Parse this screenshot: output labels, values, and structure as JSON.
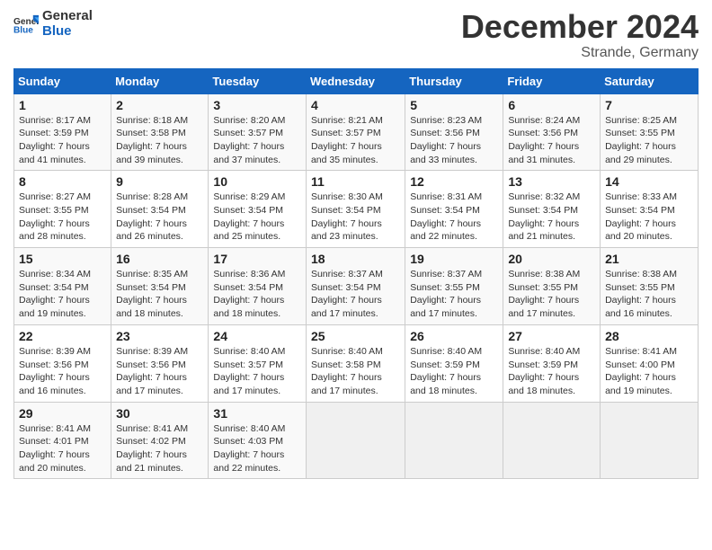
{
  "logo": {
    "line1": "General",
    "line2": "Blue"
  },
  "title": "December 2024",
  "subtitle": "Strande, Germany",
  "weekdays": [
    "Sunday",
    "Monday",
    "Tuesday",
    "Wednesday",
    "Thursday",
    "Friday",
    "Saturday"
  ],
  "weeks": [
    [
      {
        "day": "1",
        "sunrise": "8:17 AM",
        "sunset": "3:59 PM",
        "daylight": "7 hours and 41 minutes."
      },
      {
        "day": "2",
        "sunrise": "8:18 AM",
        "sunset": "3:58 PM",
        "daylight": "7 hours and 39 minutes."
      },
      {
        "day": "3",
        "sunrise": "8:20 AM",
        "sunset": "3:57 PM",
        "daylight": "7 hours and 37 minutes."
      },
      {
        "day": "4",
        "sunrise": "8:21 AM",
        "sunset": "3:57 PM",
        "daylight": "7 hours and 35 minutes."
      },
      {
        "day": "5",
        "sunrise": "8:23 AM",
        "sunset": "3:56 PM",
        "daylight": "7 hours and 33 minutes."
      },
      {
        "day": "6",
        "sunrise": "8:24 AM",
        "sunset": "3:56 PM",
        "daylight": "7 hours and 31 minutes."
      },
      {
        "day": "7",
        "sunrise": "8:25 AM",
        "sunset": "3:55 PM",
        "daylight": "7 hours and 29 minutes."
      }
    ],
    [
      {
        "day": "8",
        "sunrise": "8:27 AM",
        "sunset": "3:55 PM",
        "daylight": "7 hours and 28 minutes."
      },
      {
        "day": "9",
        "sunrise": "8:28 AM",
        "sunset": "3:54 PM",
        "daylight": "7 hours and 26 minutes."
      },
      {
        "day": "10",
        "sunrise": "8:29 AM",
        "sunset": "3:54 PM",
        "daylight": "7 hours and 25 minutes."
      },
      {
        "day": "11",
        "sunrise": "8:30 AM",
        "sunset": "3:54 PM",
        "daylight": "7 hours and 23 minutes."
      },
      {
        "day": "12",
        "sunrise": "8:31 AM",
        "sunset": "3:54 PM",
        "daylight": "7 hours and 22 minutes."
      },
      {
        "day": "13",
        "sunrise": "8:32 AM",
        "sunset": "3:54 PM",
        "daylight": "7 hours and 21 minutes."
      },
      {
        "day": "14",
        "sunrise": "8:33 AM",
        "sunset": "3:54 PM",
        "daylight": "7 hours and 20 minutes."
      }
    ],
    [
      {
        "day": "15",
        "sunrise": "8:34 AM",
        "sunset": "3:54 PM",
        "daylight": "7 hours and 19 minutes."
      },
      {
        "day": "16",
        "sunrise": "8:35 AM",
        "sunset": "3:54 PM",
        "daylight": "7 hours and 18 minutes."
      },
      {
        "day": "17",
        "sunrise": "8:36 AM",
        "sunset": "3:54 PM",
        "daylight": "7 hours and 18 minutes."
      },
      {
        "day": "18",
        "sunrise": "8:37 AM",
        "sunset": "3:54 PM",
        "daylight": "7 hours and 17 minutes."
      },
      {
        "day": "19",
        "sunrise": "8:37 AM",
        "sunset": "3:55 PM",
        "daylight": "7 hours and 17 minutes."
      },
      {
        "day": "20",
        "sunrise": "8:38 AM",
        "sunset": "3:55 PM",
        "daylight": "7 hours and 17 minutes."
      },
      {
        "day": "21",
        "sunrise": "8:38 AM",
        "sunset": "3:55 PM",
        "daylight": "7 hours and 16 minutes."
      }
    ],
    [
      {
        "day": "22",
        "sunrise": "8:39 AM",
        "sunset": "3:56 PM",
        "daylight": "7 hours and 16 minutes."
      },
      {
        "day": "23",
        "sunrise": "8:39 AM",
        "sunset": "3:56 PM",
        "daylight": "7 hours and 17 minutes."
      },
      {
        "day": "24",
        "sunrise": "8:40 AM",
        "sunset": "3:57 PM",
        "daylight": "7 hours and 17 minutes."
      },
      {
        "day": "25",
        "sunrise": "8:40 AM",
        "sunset": "3:58 PM",
        "daylight": "7 hours and 17 minutes."
      },
      {
        "day": "26",
        "sunrise": "8:40 AM",
        "sunset": "3:59 PM",
        "daylight": "7 hours and 18 minutes."
      },
      {
        "day": "27",
        "sunrise": "8:40 AM",
        "sunset": "3:59 PM",
        "daylight": "7 hours and 18 minutes."
      },
      {
        "day": "28",
        "sunrise": "8:41 AM",
        "sunset": "4:00 PM",
        "daylight": "7 hours and 19 minutes."
      }
    ],
    [
      {
        "day": "29",
        "sunrise": "8:41 AM",
        "sunset": "4:01 PM",
        "daylight": "7 hours and 20 minutes."
      },
      {
        "day": "30",
        "sunrise": "8:41 AM",
        "sunset": "4:02 PM",
        "daylight": "7 hours and 21 minutes."
      },
      {
        "day": "31",
        "sunrise": "8:40 AM",
        "sunset": "4:03 PM",
        "daylight": "7 hours and 22 minutes."
      },
      null,
      null,
      null,
      null
    ]
  ],
  "labels": {
    "sunrise": "Sunrise:",
    "sunset": "Sunset:",
    "daylight": "Daylight:"
  }
}
